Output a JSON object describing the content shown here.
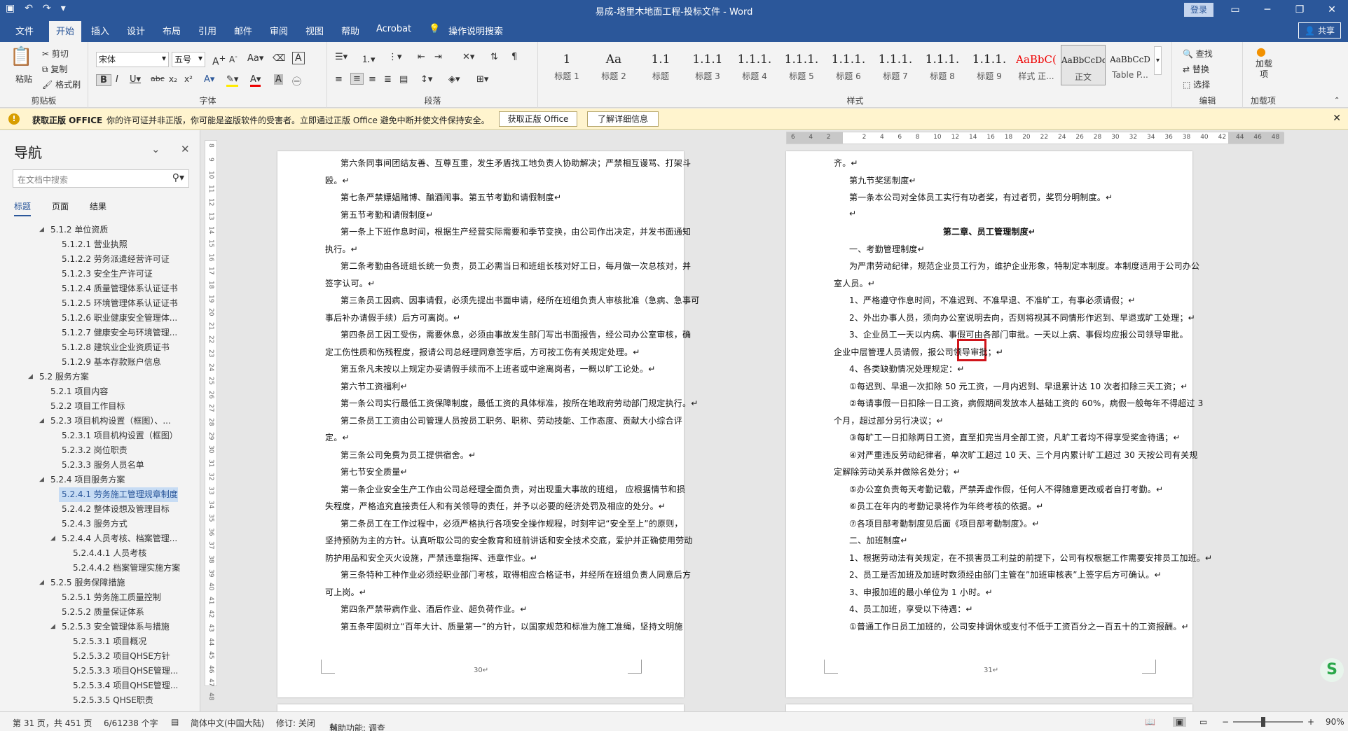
{
  "title_bar": {
    "doc_title": "易成-塔里木地面工程-投标文件  -  Word",
    "login": "登录",
    "qat": [
      "▣",
      "↶",
      "↷",
      "▾"
    ],
    "win": [
      "▭",
      "─",
      "❐",
      "✕"
    ]
  },
  "ribbon_tabs": [
    "文件",
    "开始",
    "插入",
    "设计",
    "布局",
    "引用",
    "邮件",
    "审阅",
    "视图",
    "帮助",
    "Acrobat",
    "操作说明搜索"
  ],
  "share": "共享",
  "ribbon": {
    "clipboard": {
      "paste": "粘贴",
      "cut": "剪切",
      "copy": "复制",
      "format_painter": "格式刷",
      "label": "剪贴板"
    },
    "font": {
      "font_name": "宋体",
      "font_size": "五号",
      "label": "字体"
    },
    "paragraph": {
      "label": "段落"
    },
    "styles": {
      "label": "样式",
      "items": [
        {
          "preview": "1",
          "name": "标题 1"
        },
        {
          "preview": "Aa",
          "name": "标题 2"
        },
        {
          "preview": "1.1",
          "name": "标题"
        },
        {
          "preview": "1.1.1",
          "name": "标题 3"
        },
        {
          "preview": "1.1.1.",
          "name": "标题 4"
        },
        {
          "preview": "1.1.1.",
          "name": "标题 5"
        },
        {
          "preview": "1.1.1.",
          "name": "标题 6"
        },
        {
          "preview": "1.1.1.",
          "name": "标题 7"
        },
        {
          "preview": "1.1.1.",
          "name": "标题 8"
        },
        {
          "preview": "1.1.1.",
          "name": "标题 9"
        },
        {
          "preview": "AaBbC(",
          "name": "样式 正..."
        },
        {
          "preview": "AaBbCcDd",
          "name": "正文"
        },
        {
          "preview": "AaBbCcD",
          "name": "Table P..."
        }
      ]
    },
    "editing": {
      "find": "查找",
      "replace": "替换",
      "select": "选择",
      "label": "编辑"
    },
    "addins": {
      "name": "加载项",
      "label": "加载项"
    }
  },
  "info_bar": {
    "title": "获取正版 OFFICE",
    "message": "你的许可证并非正版，你可能是盗版软件的受害者。立即通过正版 Office 避免中断并使文件保持安全。",
    "btn_get": "获取正版 Office",
    "btn_learn": "了解详细信息"
  },
  "nav": {
    "title": "导航",
    "search_placeholder": "在文档中搜索",
    "tabs": [
      "标题",
      "页面",
      "结果"
    ],
    "items": [
      {
        "text": "5.1.2 单位资质",
        "level": 3,
        "expand": true
      },
      {
        "text": "5.1.2.1 营业执照",
        "level": 4
      },
      {
        "text": "5.1.2.2 劳务派遣经营许可证",
        "level": 4
      },
      {
        "text": "5.1.2.3 安全生产许可证",
        "level": 4
      },
      {
        "text": "5.1.2.4 质量管理体系认证证书",
        "level": 4
      },
      {
        "text": "5.1.2.5 环境管理体系认证证书",
        "level": 4
      },
      {
        "text": "5.1.2.6 职业健康安全管理体...",
        "level": 4
      },
      {
        "text": "5.1.2.7 健康安全与环境管理...",
        "level": 4
      },
      {
        "text": "5.1.2.8 建筑业企业资质证书",
        "level": 4
      },
      {
        "text": "5.1.2.9 基本存款账户信息",
        "level": 4
      },
      {
        "text": "5.2 服务方案",
        "level": 2,
        "expand": true
      },
      {
        "text": "5.2.1 项目内容",
        "level": 3
      },
      {
        "text": "5.2.2 项目工作目标",
        "level": 3
      },
      {
        "text": "5.2.3 项目机构设置（框图）、...",
        "level": 3,
        "expand": true
      },
      {
        "text": "5.2.3.1 项目机构设置（框图）",
        "level": 4
      },
      {
        "text": "5.2.3.2 岗位职责",
        "level": 4
      },
      {
        "text": "5.2.3.3 服务人员名单",
        "level": 4
      },
      {
        "text": "5.2.4 项目服务方案",
        "level": 3,
        "expand": true
      },
      {
        "text": "5.2.4.1 劳务施工管理规章制度",
        "level": 4,
        "selected": true
      },
      {
        "text": "5.2.4.2 整体设想及管理目标",
        "level": 4
      },
      {
        "text": "5.2.4.3 服务方式",
        "level": 4
      },
      {
        "text": "5.2.4.4 人员考核、档案管理...",
        "level": 4,
        "expand": true
      },
      {
        "text": "5.2.4.4.1 人员考核",
        "level": 5
      },
      {
        "text": "5.2.4.4.2 档案管理实施方案",
        "level": 5
      },
      {
        "text": "5.2.5 服务保障措施",
        "level": 3,
        "expand": true
      },
      {
        "text": "5.2.5.1 劳务施工质量控制",
        "level": 4
      },
      {
        "text": "5.2.5.2 质量保证体系",
        "level": 4
      },
      {
        "text": "5.2.5.3 安全管理体系与措施",
        "level": 4,
        "expand": true
      },
      {
        "text": "5.2.5.3.1 项目概况",
        "level": 5
      },
      {
        "text": "5.2.5.3.2 项目QHSE方针",
        "level": 5
      },
      {
        "text": "5.2.5.3.3 项目QHSE管理...",
        "level": 5
      },
      {
        "text": "5.2.5.3.4 项目QHSE管理...",
        "level": 5
      },
      {
        "text": "5.2.5.3.5 QHSE职责",
        "level": 5
      }
    ]
  },
  "left_page": {
    "page_number": "30↵",
    "lines": [
      {
        "t": "第六条同事间团结友善、互尊互重，发生矛盾找工地负责人协助解决；严禁相互谩骂、打架斗",
        "indent": true
      },
      {
        "t": "殴。↵",
        "indent": false
      },
      {
        "t": "第七条严禁嫖娼赌博、酗酒闹事。第五节考勤和请假制度↵",
        "indent": true
      },
      {
        "t": "第五节考勤和请假制度↵",
        "indent": true
      },
      {
        "t": "第一条上下班作息时间，根据生产经营实际需要和季节变换，由公司作出决定，并发书面通知",
        "indent": true
      },
      {
        "t": "执行。↵",
        "indent": false
      },
      {
        "t": "第二条考勤由各班组长统一负责，员工必需当日和班组长核对好工日，每月做一次总核对，并",
        "indent": true
      },
      {
        "t": "签字认可。↵",
        "indent": false
      },
      {
        "t": "第三条员工因病、因事请假，必须先提出书面申请，经所在班组负责人审核批准（急病、急事可",
        "indent": true
      },
      {
        "t": "事后补办请假手续）后方可离岗。↵",
        "indent": false
      },
      {
        "t": "第四条员工因工受伤，需要休息，必须由事故发生部门写出书面报告，经公司办公室审核，确",
        "indent": true
      },
      {
        "t": "定工伤性质和伤残程度，报请公司总经理同意签字后，方可按工伤有关规定处理。↵",
        "indent": false
      },
      {
        "t": "第五条凡未按以上规定办妥请假手续而不上班者或中途离岗者，一概以旷工论处。↵",
        "indent": true
      },
      {
        "t": "第六节工资福利↵",
        "indent": true
      },
      {
        "t": "第一条公司实行最低工资保障制度，最低工资的具体标准，按所在地政府劳动部门规定执行。↵",
        "indent": true
      },
      {
        "t": "第二条员工工资由公司管理人员按员工职务、职称、劳动技能、工作态度、贡献大小综合评",
        "indent": true
      },
      {
        "t": "定。↵",
        "indent": false
      },
      {
        "t": "第三条公司免费为员工提供宿舍。↵",
        "indent": true
      },
      {
        "t": "第七节安全质量↵",
        "indent": true
      },
      {
        "t": "第一条企业安全生产工作由公司总经理全面负责，对出现重大事故的班组， 应根据情节和损",
        "indent": true
      },
      {
        "t": "失程度，严格追究直接责任人和有关领导的责任，并予以必要的经济处罚及相应的处分。↵",
        "indent": false
      },
      {
        "t": "第二条员工在工作过程中，必须严格执行各项安全操作规程，时刻牢记“安全至上”的原则，",
        "indent": true
      },
      {
        "t": "坚持预防为主的方针。认真听取公司的安全教育和班前讲话和安全技术交底，爱护并正确使用劳动",
        "indent": false
      },
      {
        "t": "防护用品和安全灭火设施，严禁违章指挥、违章作业。↵",
        "indent": false
      },
      {
        "t": "第三条特种工种作业必须经职业部门考核，取得相应合格证书，并经所在班组负责人同意后方",
        "indent": true
      },
      {
        "t": "可上岗。↵",
        "indent": false
      },
      {
        "t": "第四条严禁带病作业、酒后作业、超负荷作业。↵",
        "indent": true
      },
      {
        "t": "第五条牢固树立“百年大计、质量第一”的方针，以国家规范和标准为施工准绳，坚持文明施",
        "indent": true
      }
    ]
  },
  "right_page": {
    "page_number": "31↵",
    "lines": [
      {
        "t": "齐。↵",
        "indent": false
      },
      {
        "t": "第九节奖惩制度↵",
        "indent": true
      },
      {
        "t": "第一条本公司对全体员工实行有功者奖，有过者罚，奖罚分明制度。↵",
        "indent": true
      },
      {
        "t": "↵",
        "indent": true
      },
      {
        "t": "第二章、员工管理制度↵",
        "center": true
      },
      {
        "t": "一、考勤管理制度↵",
        "indent": true
      },
      {
        "t": "为严肃劳动纪律，规范企业员工行为，维护企业形象，特制定本制度。本制度适用于公司办公",
        "indent": true
      },
      {
        "t": "室人员。↵",
        "indent": false
      },
      {
        "t": "1、严格遵守作息时间，不准迟到、不准早退、不准旷工，有事必须请假；↵",
        "indent": true
      },
      {
        "t": "2、外出办事人员，须向办公室说明去向，否则将视其不同情形作迟到、早退或旷工处理；↵",
        "indent": true
      },
      {
        "t": "3、企业员工一天以内病、事假可由各部门审批。一天以上病、事假均应报公司领导审批。",
        "indent": true
      },
      {
        "t": "企业中层管理人员请假，报公司领导审批；↵",
        "indent": false
      },
      {
        "t": "4、各类缺勤情况处理规定：↵",
        "indent": true
      },
      {
        "t": "①每迟到、早退一次扣除 50 元工资，一月内迟到、早退累计达 10 次者扣除三天工资；↵",
        "indent": true
      },
      {
        "t": "②每请事假一日扣除一日工资，病假期间发放本人基础工资的 60%，病假一般每年不得超过 3",
        "indent": true
      },
      {
        "t": "个月，超过部分另行决议；↵",
        "indent": false
      },
      {
        "t": "③每旷工一日扣除两日工资，直至扣完当月全部工资，凡旷工者均不得享受奖金待遇；↵",
        "indent": true
      },
      {
        "t": "④对严重违反劳动纪律者，单次旷工超过 10 天、三个月内累计旷工超过 30 天按公司有关规",
        "indent": true
      },
      {
        "t": "定解除劳动关系并做除名处分；↵",
        "indent": false
      },
      {
        "t": "⑤办公室负责每天考勤记载，严禁弄虚作假，任何人不得随意更改或者自打考勤。↵",
        "indent": true
      },
      {
        "t": "⑥员工在年内的考勤记录将作为年终考核的依据。↵",
        "indent": true
      },
      {
        "t": "⑦各项目部考勤制度见后面《项目部考勤制度》。↵",
        "indent": true
      },
      {
        "t": "二、加班制度↵",
        "indent": true
      },
      {
        "t": "1、根据劳动法有关规定，在不损害员工利益的前提下，公司有权根据工作需要安排员工加班。↵",
        "indent": true
      },
      {
        "t": "2、员工是否加班及加班时数须经由部门主管在”加班审核表”上签字后方可确认。↵",
        "indent": true
      },
      {
        "t": "3、申报加班的最小单位为 1 小时。↵",
        "indent": true
      },
      {
        "t": "4、员工加班，享受以下待遇：↵",
        "indent": true
      },
      {
        "t": "①普通工作日员工加班的，公司安排调休或支付不低于工资百分之一百五十的工资报酬。↵",
        "indent": true
      }
    ]
  },
  "hruler_ticks": [
    "6",
    "4",
    "2",
    "",
    "2",
    "4",
    "6",
    "8",
    "10",
    "12",
    "14",
    "16",
    "18",
    "20",
    "22",
    "24",
    "26",
    "28",
    "30",
    "32",
    "34",
    "36",
    "38",
    "40",
    "42",
    "44",
    "46",
    "48"
  ],
  "vruler_ticks": [
    "8",
    "9",
    "10",
    "11",
    "12",
    "13",
    "14",
    "15",
    "16",
    "17",
    "18",
    "19",
    "20",
    "21",
    "22",
    "23",
    "24",
    "25",
    "26",
    "27",
    "28",
    "29",
    "30",
    "31",
    "32",
    "33",
    "34",
    "35",
    "36",
    "37",
    "38",
    "39",
    "40",
    "41",
    "42",
    "43",
    "44",
    "45",
    "46",
    "47",
    "48"
  ],
  "status": {
    "page": "第 31 页，共 451 页",
    "words": "6/61238 个字",
    "lang": "简体中文(中国大陆)",
    "track": "修订: 关闭",
    "accessibility": "辅助功能: 调查",
    "zoom": "90%"
  }
}
